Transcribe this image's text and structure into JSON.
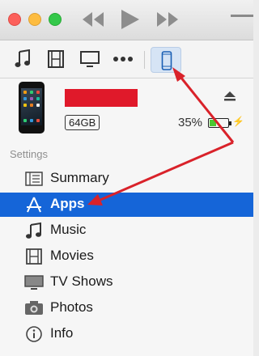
{
  "toolbar": {
    "icons": [
      "music-note-icon",
      "film-icon",
      "tv-icon",
      "more-icon",
      "iphone-icon"
    ]
  },
  "device": {
    "capacity": "64GB",
    "battery_percent": "35%",
    "battery_level": 0.35
  },
  "settings": {
    "section_label": "Settings",
    "items": [
      {
        "label": "Summary",
        "icon": "summary-icon"
      },
      {
        "label": "Apps",
        "icon": "apps-icon"
      },
      {
        "label": "Music",
        "icon": "music-icon"
      },
      {
        "label": "Movies",
        "icon": "movies-icon"
      },
      {
        "label": "TV Shows",
        "icon": "tv-shows-icon"
      },
      {
        "label": "Photos",
        "icon": "photos-icon"
      },
      {
        "label": "Info",
        "icon": "info-icon"
      }
    ],
    "selected_index": 1
  },
  "colors": {
    "selection": "#1565d8",
    "annotation_arrow": "#d9222a",
    "redaction": "#e0192a"
  }
}
